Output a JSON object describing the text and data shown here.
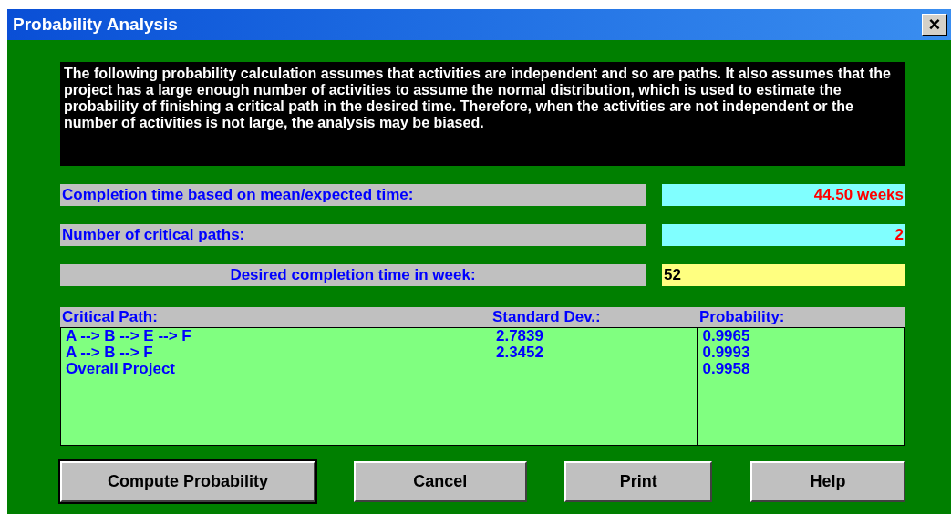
{
  "window": {
    "title": "Probability Analysis",
    "close": "×"
  },
  "notice": "The following probability calculation assumes that activities are independent and so are paths. It also assumes that the project has a large enough number of activities to assume the normal distribution, which is used to estimate the probability of finishing a critical path in the desired time.  Therefore, when the activities are not independent or the number of activities is not large, the analysis may be biased.",
  "fields": [
    {
      "label": "Completion time based on mean/expected time:",
      "value": "44.50 weeks",
      "kind": "output"
    },
    {
      "label": "Number of critical paths:",
      "value": "2",
      "kind": "output"
    },
    {
      "label": "Desired completion time in week:",
      "value": "52",
      "kind": "input"
    }
  ],
  "table": {
    "columns": [
      "Critical Path:",
      "Standard Dev.:",
      "Probability:"
    ],
    "rows": [
      [
        "A --> B --> E --> F",
        "2.7839",
        "0.9965"
      ],
      [
        "A --> B --> F",
        "2.3452",
        "0.9993"
      ],
      [
        "Overall Project",
        "",
        "0.9958"
      ]
    ]
  },
  "buttons": [
    {
      "label": "Compute Probability",
      "default": true
    },
    {
      "label": "Cancel",
      "default": false
    },
    {
      "label": "Print",
      "default": false
    },
    {
      "label": "Help",
      "default": false
    }
  ]
}
